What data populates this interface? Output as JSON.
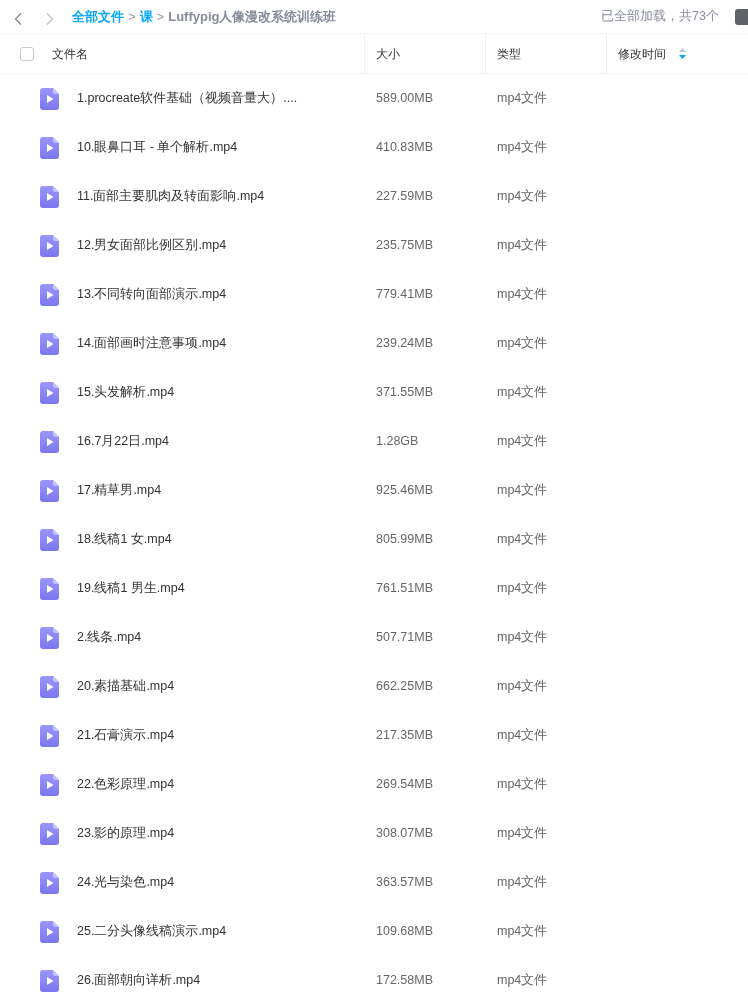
{
  "nav": {
    "back": {
      "disabled": false
    },
    "forward": {
      "disabled": true
    }
  },
  "breadcrumb": [
    {
      "kind": "link",
      "label": "全部文件"
    },
    {
      "kind": "separator",
      "label": ">"
    },
    {
      "kind": "link",
      "label": "课"
    },
    {
      "kind": "separator",
      "label": ">"
    },
    {
      "kind": "current",
      "label": "Luffypig人像漫改系统训练班"
    }
  ],
  "load_status": "已全部加载，共73个",
  "table": {
    "select_all": {
      "checked": false
    },
    "columns": [
      {
        "label": "文件名",
        "sorted": false
      },
      {
        "label": "大小",
        "sorted": false
      },
      {
        "label": "类型",
        "sorted": false
      },
      {
        "label": "修改时间",
        "sorted": true
      }
    ],
    "rows": [
      {
        "name": "1.procreate软件基础（视频音量大）....",
        "size": "589.00MB",
        "type": "mp4文件"
      },
      {
        "name": "10.眼鼻口耳 - 单个解析.mp4",
        "size": "410.83MB",
        "type": "mp4文件"
      },
      {
        "name": "11.面部主要肌肉及转面影响.mp4",
        "size": "227.59MB",
        "type": "mp4文件"
      },
      {
        "name": "12.男女面部比例区别.mp4",
        "size": "235.75MB",
        "type": "mp4文件"
      },
      {
        "name": "13.不同转向面部演示.mp4",
        "size": "779.41MB",
        "type": "mp4文件"
      },
      {
        "name": "14.面部画时注意事项.mp4",
        "size": "239.24MB",
        "type": "mp4文件"
      },
      {
        "name": "15.头发解析.mp4",
        "size": "371.55MB",
        "type": "mp4文件"
      },
      {
        "name": "16.7月22日.mp4",
        "size": "1.28GB",
        "type": "mp4文件"
      },
      {
        "name": "17.精草男.mp4",
        "size": "925.46MB",
        "type": "mp4文件"
      },
      {
        "name": "18.线稿1 女.mp4",
        "size": "805.99MB",
        "type": "mp4文件"
      },
      {
        "name": "19.线稿1 男生.mp4",
        "size": "761.51MB",
        "type": "mp4文件"
      },
      {
        "name": "2.线条.mp4",
        "size": "507.71MB",
        "type": "mp4文件"
      },
      {
        "name": "20.素描基础.mp4",
        "size": "662.25MB",
        "type": "mp4文件"
      },
      {
        "name": "21.石膏演示.mp4",
        "size": "217.35MB",
        "type": "mp4文件"
      },
      {
        "name": "22.色彩原理.mp4",
        "size": "269.54MB",
        "type": "mp4文件"
      },
      {
        "name": "23.影的原理.mp4",
        "size": "308.07MB",
        "type": "mp4文件"
      },
      {
        "name": "24.光与染色.mp4",
        "size": "363.57MB",
        "type": "mp4文件"
      },
      {
        "name": "25.二分头像线稿演示.mp4",
        "size": "109.68MB",
        "type": "mp4文件"
      },
      {
        "name": "26.面部朝向详析.mp4",
        "size": "172.58MB",
        "type": "mp4文件"
      }
    ]
  }
}
